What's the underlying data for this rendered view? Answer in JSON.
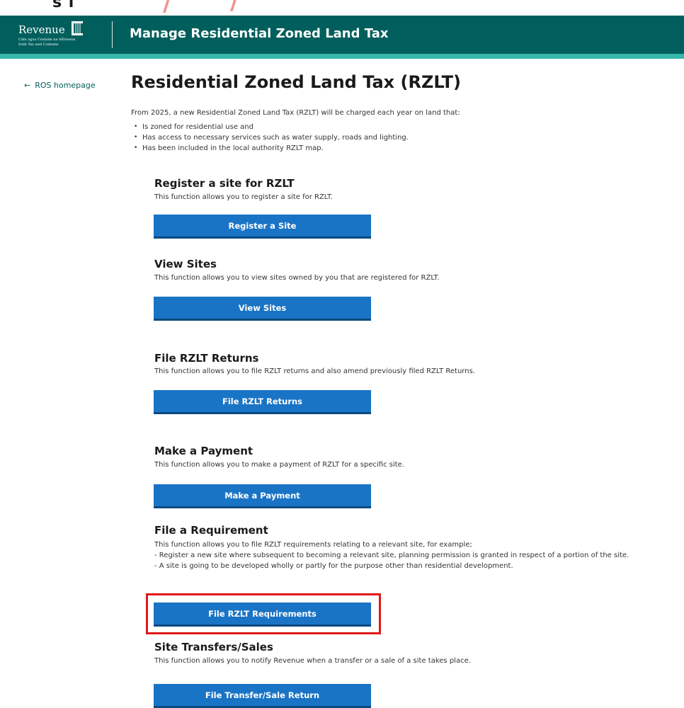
{
  "top_partial": "s   i",
  "header": {
    "logo_word": "Revenue",
    "logo_sub1": "Cáin agus Custaim na hÉireann",
    "logo_sub2": "Irish Tax and Customs",
    "title": "Manage Residential Zoned Land Tax"
  },
  "nav": {
    "back_arrow": "←",
    "back_label": "ROS homepage"
  },
  "page": {
    "title": "Residential Zoned Land Tax (RZLT)",
    "intro": "From 2025, a new Residential Zoned Land Tax (RZLT) will be charged each year on land that:",
    "bullets": [
      "Is zoned for residential use and",
      "Has access to necessary services such as water supply, roads and lighting.",
      "Has been included in the local authority RZLT map."
    ]
  },
  "sections": [
    {
      "title": "Register a site for RZLT",
      "desc": "This function allows you to register a site for RZLT.",
      "button": "Register a Site"
    },
    {
      "title": "View Sites",
      "desc": "This function allows you to view sites owned by you that are registered for RZLT.",
      "button": "View Sites"
    },
    {
      "title": "File RZLT Returns",
      "desc": "This function allows you to file RZLT returns and also amend previously filed RZLT Returns.",
      "button": "File RZLT Returns"
    },
    {
      "title": "Make a Payment",
      "desc": "This function allows you to make a payment of RZLT for a specific site.",
      "button": "Make a Payment"
    },
    {
      "title": "File a Requirement",
      "desc_lines": [
        "This function allows you to file RZLT requirements relating to a relevant site, for example;",
        "- Register a new site where subsequent to becoming a relevant site, planning permission is granted in respect of a portion of the site.",
        "- A site is going to be developed wholly or partly for the purpose other than residential development."
      ],
      "button": "File RZLT Requirements"
    },
    {
      "title": "Site Transfers/Sales",
      "desc": "This function allows you to notify Revenue when a transfer or a sale of a site takes place.",
      "button": "File Transfer/Sale Return"
    }
  ],
  "colors": {
    "header_bg": "#005f5c",
    "header_accent": "#35b5ac",
    "button_bg": "#1a74c5",
    "highlight_border": "#e0181b"
  }
}
